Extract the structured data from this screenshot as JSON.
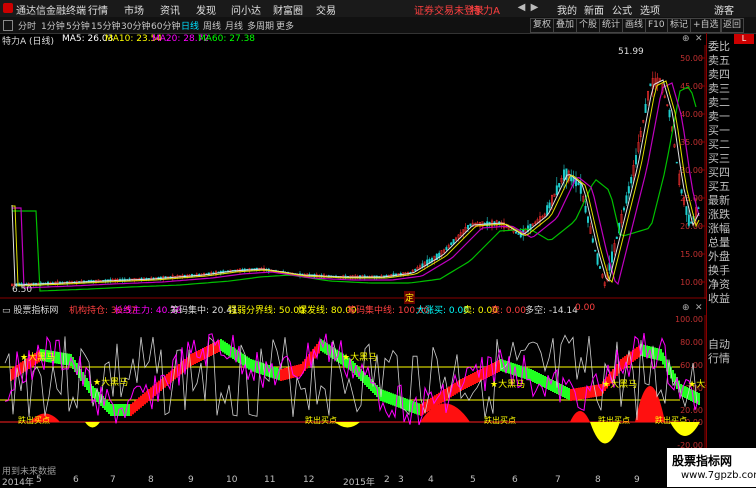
{
  "app": {
    "title": "通达信金融终端",
    "login_status": "证券交易未登录",
    "stock_name": "特 力A"
  },
  "menu": [
    "行情",
    "市场",
    "资讯",
    "发现",
    "问小达",
    "财富圈",
    "交易"
  ],
  "menu_right": [
    "我的",
    "新面",
    "公式",
    "选项"
  ],
  "user": "游客",
  "periods": [
    "分时",
    "1分钟",
    "5分钟",
    "15分钟",
    "30分钟",
    "60分钟",
    "日线",
    "周线",
    "月线",
    "多周期",
    "更多"
  ],
  "active_period": "日线",
  "toolbar_right": [
    "复权",
    "叠加",
    "个股",
    "统计",
    "画线",
    "F10",
    "标记",
    "+自选",
    "返回"
  ],
  "main_info": {
    "stock": "特力A (日线)",
    "ma5": "MA5: 26.03",
    "ma10": "MA10: 23.54",
    "ma20": "MA20: 28.72",
    "ma60": "MA60: 27.38",
    "colors": {
      "ma5": "#ffffff",
      "ma10": "#ffff00",
      "ma20": "#ff00ff",
      "ma60": "#00ff00"
    }
  },
  "price_axis": [
    "50.00",
    "45.00",
    "40.00",
    "35.00",
    "30.00",
    "25.00",
    "20.00",
    "15.00",
    "10.00"
  ],
  "high_label": "51.99",
  "low_label": "6.50",
  "marker_label": "定",
  "indicator_info": {
    "name": "股票指标网",
    "f1": "机构持仓: 30.57",
    "f2": "长线主力: 40.36",
    "f3": "筹码集中: 20.41",
    "f4": "强弱分界线: 50.00",
    "f5": "爆发线: 80.00",
    "f6": "筹码集中线: 100.00",
    "f7": "大涨买: 0.00",
    "f8": "卖: 0.00",
    "f9": "卖: 0.00",
    "f10": "多空: -14.14",
    "f11": "0.00"
  },
  "ind_axis": [
    "100.00",
    "80.00",
    "60.00",
    "40.00",
    "20.00",
    "0.00",
    "-20.00"
  ],
  "signals": {
    "buy": "★大黑马",
    "bottom": "跌出买点"
  },
  "sidebar": [
    "委比",
    "卖五",
    "卖四",
    "卖三",
    "卖二",
    "卖一",
    "买一",
    "买二",
    "买三",
    "买四",
    "买五",
    "最新",
    "涨跌",
    "涨幅",
    "总量",
    "外盘",
    "换手",
    "净资",
    "收益",
    "自动",
    "行情"
  ],
  "footer_note": "用到未来数据",
  "dates": [
    "2014年",
    "5",
    "6",
    "7",
    "8",
    "9",
    "10",
    "11",
    "12",
    "2015年",
    "2",
    "3",
    "4",
    "5",
    "6",
    "7",
    "8",
    "9"
  ],
  "watermark": {
    "line1": "股票指标网",
    "line2": "www.7gpzb.com"
  }
}
